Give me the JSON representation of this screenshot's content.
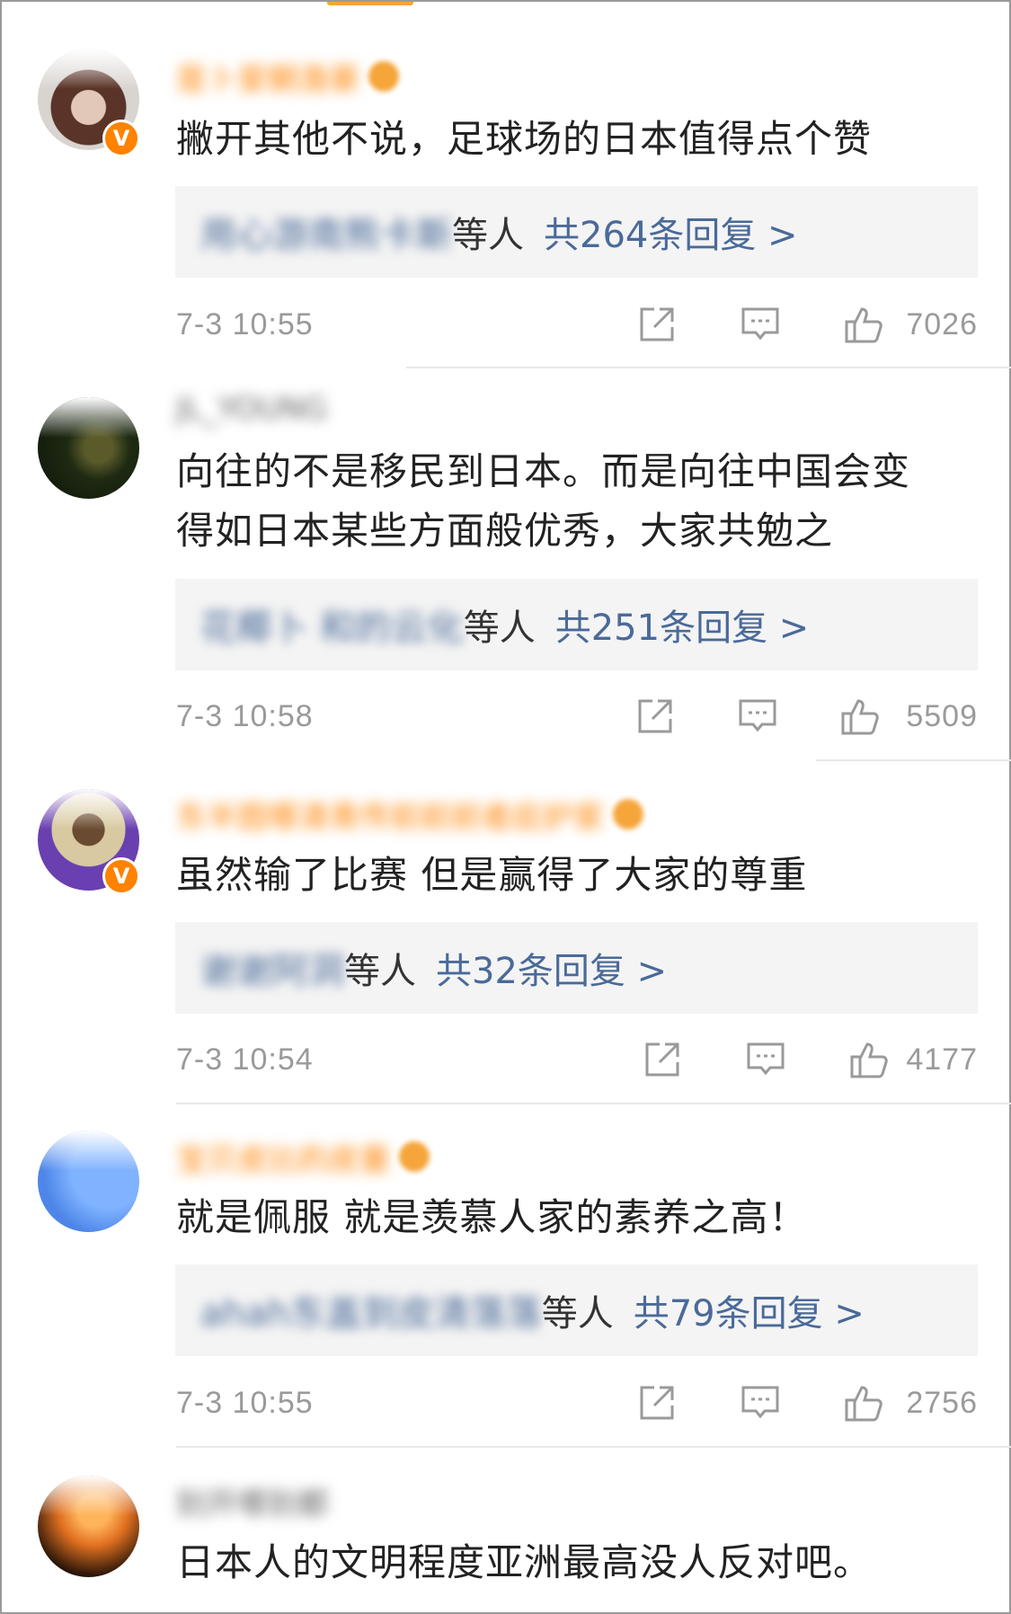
{
  "comments": [
    {
      "username": "是卜爱朝澹豪",
      "text": [
        "撇开其他不说，足球场的日本值得点个赞"
      ],
      "verified": true,
      "reply_names": "用心游南熊卡斯",
      "reply_suffix": "等人",
      "reply_count": "共264条回复 >",
      "time": "7-3 10:55",
      "likes": "7026"
    },
    {
      "username": "JL_YOUNG",
      "text": [
        "向往的不是移民到日本。而是向往中国会变",
        "得如日本某些方面般优秀，大家共勉之"
      ],
      "verified": false,
      "reply_names": "花椰卜 和的云化",
      "reply_suffix": "等人",
      "reply_count": "共251条回复 >",
      "time": "7-3 10:58",
      "likes": "5509"
    },
    {
      "username": "东半图哪清青传前前前者庇护家",
      "text": [
        "虽然输了比赛 但是赢得了大家的尊重"
      ],
      "verified": true,
      "reply_names": "谢谢阿洞",
      "reply_suffix": "等人",
      "reply_count": "共32条回复 >",
      "time": "7-3 10:54",
      "likes": "4177"
    },
    {
      "username": "宝贝皮比的皮童",
      "text": [
        "就是佩服 就是羡慕人家的素养之高！"
      ],
      "verified": false,
      "reply_names": "ahah东盖到皮清落落",
      "reply_suffix": "等人",
      "reply_count": "共79条回复 >",
      "time": "7-3 10:55",
      "likes": "2756"
    },
    {
      "username": "别开哪别都",
      "text": [
        "日本人的文明程度亚洲最高没人反对吧。"
      ],
      "verified": false
    }
  ],
  "icons": {
    "share": "share-icon",
    "comment": "comment-icon",
    "like": "thumbs-up-icon",
    "verified": "verified-badge-icon"
  },
  "colors": {
    "accent": "#ff8200",
    "link": "#4a6a99",
    "text": "#222222",
    "meta": "#9a9a9a",
    "reply_bg": "#f4f4f4"
  }
}
